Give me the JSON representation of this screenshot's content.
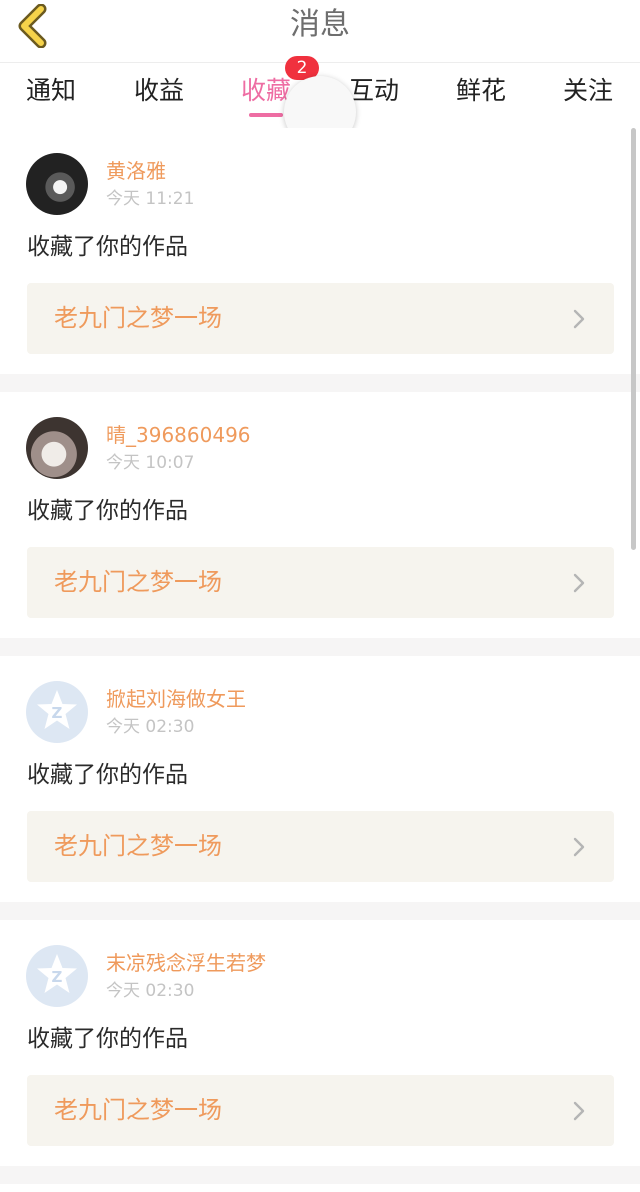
{
  "header": {
    "title": "消息"
  },
  "tabs": [
    {
      "label": "通知"
    },
    {
      "label": "收益"
    },
    {
      "label": "收藏",
      "badge": "2"
    },
    {
      "label": "互动"
    },
    {
      "label": "鲜花"
    },
    {
      "label": "关注"
    }
  ],
  "active_tab": "收藏",
  "colors": {
    "accent": "#ee6da3",
    "name": "#ef9a5c",
    "badge": "#f0313e"
  },
  "items": [
    {
      "name": "黄洛雅",
      "time": "今天 11:21",
      "action": "收藏了你的作品",
      "work": "老九门之梦一场",
      "avatar": "photo-avatar"
    },
    {
      "name": "晴_396860496",
      "time": "今天 10:07",
      "action": "收藏了你的作品",
      "work": "老九门之梦一场",
      "avatar": "photo-avatar"
    },
    {
      "name": "掀起刘海做女王",
      "time": "今天 02:30",
      "action": "收藏了你的作品",
      "work": "老九门之梦一场",
      "avatar": "default-avatar"
    },
    {
      "name": "末凉残念浮生若梦",
      "time": "今天 02:30",
      "action": "收藏了你的作品",
      "work": "老九门之梦一场",
      "avatar": "default-avatar"
    }
  ]
}
